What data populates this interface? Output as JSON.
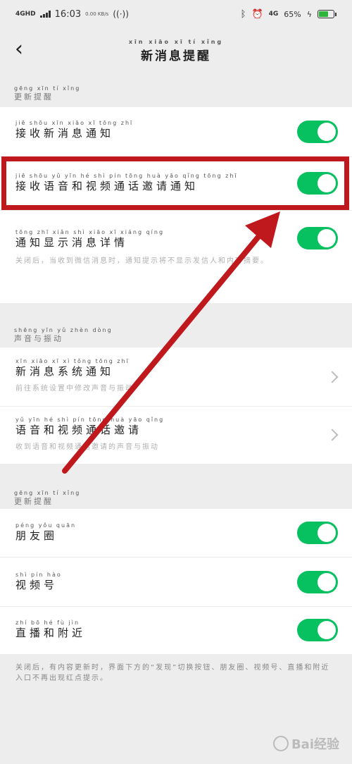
{
  "status_bar": {
    "network": "4GHD",
    "time": "16:03",
    "speed": "0.00 KB/s",
    "network_right": "4G",
    "battery": "65%",
    "battery_level": 0.65
  },
  "header": {
    "title_pinyin": "xīn xiāo xī tí xǐng",
    "title": "新消息提醒"
  },
  "sections": {
    "update_reminder": {
      "label_pinyin": "gēng xīn tí xǐng",
      "label": "更新提醒",
      "items": [
        {
          "pinyin": "jiē shōu xīn xiāo xī tōng zhī",
          "label": "接收新消息通知",
          "on": true
        },
        {
          "pinyin": "jiē shōu yǔ yīn hé shì pín tōng huà yāo qǐng tōng zhī",
          "label": "接收语音和视频通话邀请通知",
          "on": true
        },
        {
          "pinyin": "tōng zhī xiǎn shì xiāo xī xiáng qíng",
          "label": "通知显示消息详情",
          "on": true,
          "desc": "关闭后，当收到微信消息时，通知提示将不显示发信人和内容摘要。"
        }
      ]
    },
    "sound_vibration": {
      "label_pinyin": "shēng yīn yǔ zhèn dòng",
      "label": "声音与振动",
      "items": [
        {
          "pinyin": "xīn xiāo xī xì tǒng tōng zhī",
          "label": "新消息系统通知",
          "desc": "前往系统设置中修改声音与振动"
        },
        {
          "pinyin": "yǔ yīn hé shì pín tōng huà yāo qǐng",
          "label": "语音和视频通话邀请",
          "desc": "收到语音和视频通话邀请的声音与振动"
        }
      ]
    },
    "update_reminder_2": {
      "label_pinyin": "gēng xīn tí xǐng",
      "label": "更新提醒",
      "items": [
        {
          "pinyin": "péng yǒu quān",
          "label": "朋友圈",
          "on": true
        },
        {
          "pinyin": "shì pín hào",
          "label": "视频号",
          "on": true
        },
        {
          "pinyin": "zhí bō hé fù jìn",
          "label": "直播和附近",
          "on": true
        }
      ],
      "footer": "关闭后，有内容更新时，界面下方的“发现”切换按钮、朋友圈、视频号、直播和附近入口不再出现红点提示。"
    }
  },
  "watermark": "Bai经验"
}
